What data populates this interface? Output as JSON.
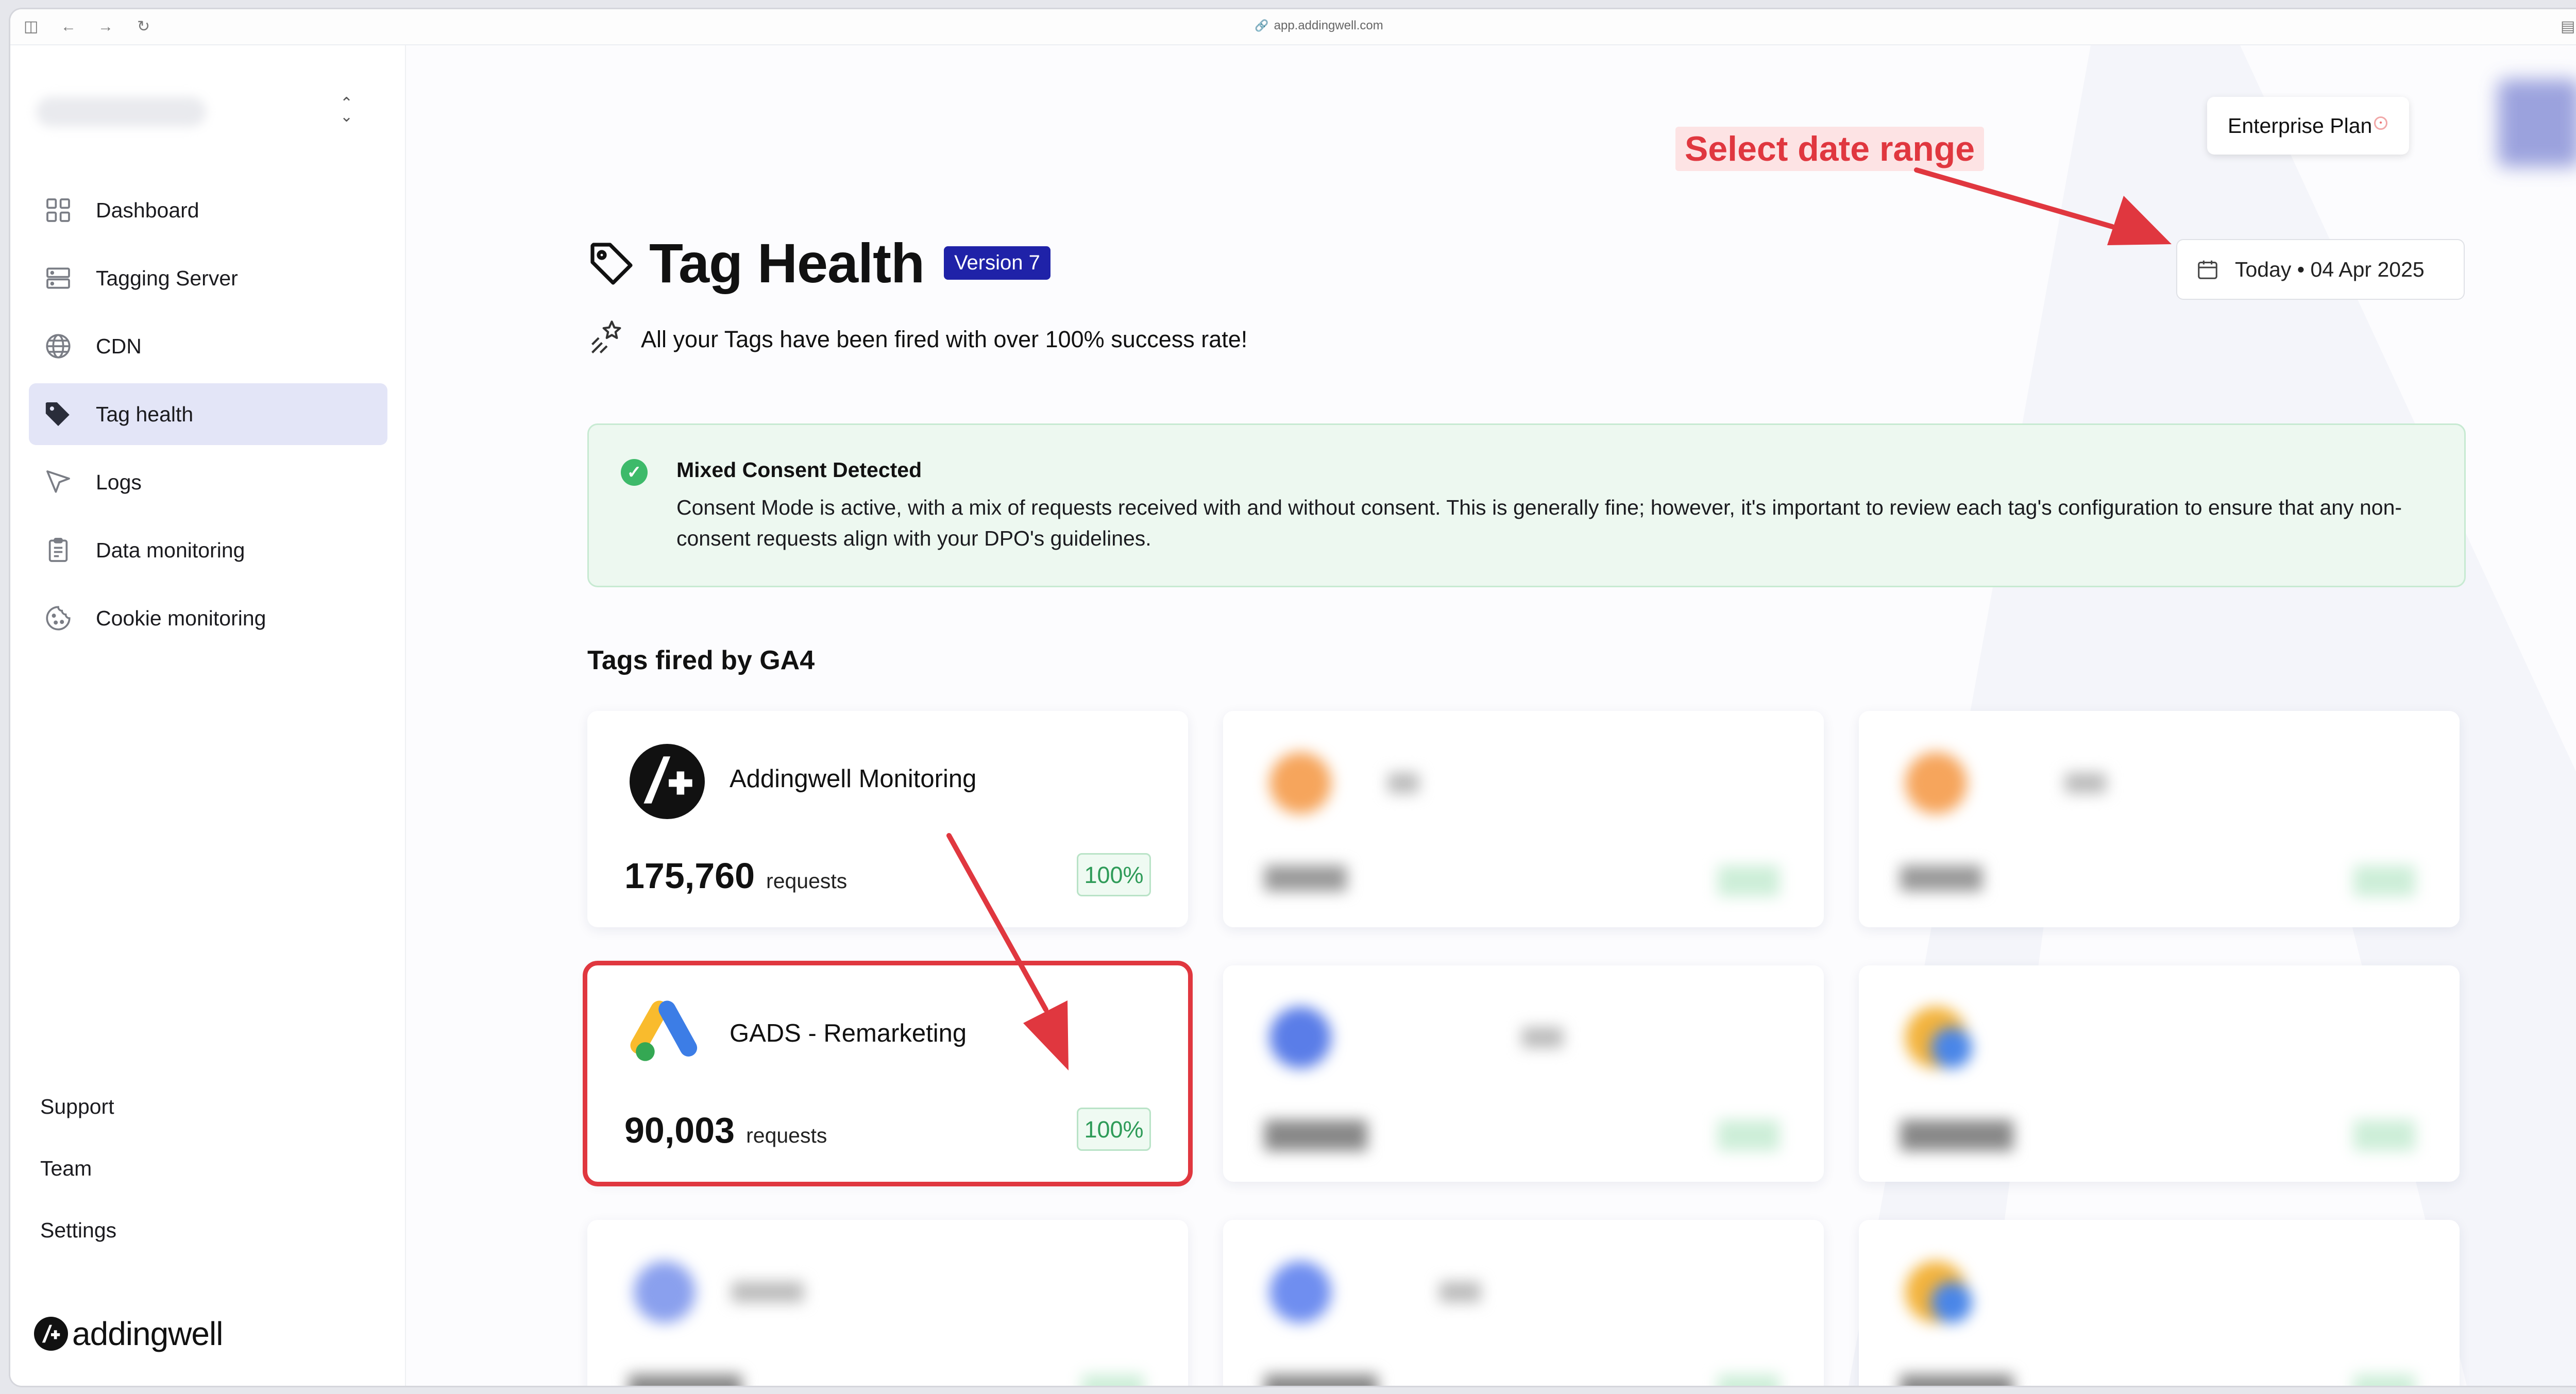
{
  "browser": {
    "url": "app.addingwell.com"
  },
  "sidebar": {
    "items": [
      {
        "label": "Dashboard",
        "icon": "grid-icon"
      },
      {
        "label": "Tagging Server",
        "icon": "server-icon"
      },
      {
        "label": "CDN",
        "icon": "globe-icon"
      },
      {
        "label": "Tag health",
        "icon": "tag-icon",
        "active": true
      },
      {
        "label": "Logs",
        "icon": "cursor-icon"
      },
      {
        "label": "Data monitoring",
        "icon": "clipboard-icon"
      },
      {
        "label": "Cookie monitoring",
        "icon": "cookie-icon"
      }
    ],
    "bottom": {
      "support": "Support",
      "team": "Team",
      "settings": "Settings"
    },
    "logo": "addingwell"
  },
  "header": {
    "plan_label": "Enterprise Plan",
    "date_range": "Today • 04 Apr 2025",
    "annotation": "Select date range"
  },
  "page": {
    "title": "Tag Health",
    "version": "Version 7",
    "subtitle": "All your Tags have been fired with over 100% success rate!"
  },
  "alert": {
    "title": "Mixed Consent Detected",
    "body": "Consent Mode is active, with a mix of requests received with and without consent. This is generally fine; however, it's important to review each tag's configuration to ensure that any non-consent requests align with your DPO's guidelines."
  },
  "section_title": "Tags fired by GA4",
  "tags": [
    {
      "name": "Addingwell Monitoring",
      "count": "175,760",
      "unit": "requests",
      "rate": "100%",
      "icon": "addingwell-logo-icon"
    },
    {
      "name": "GADS - Remarketing",
      "count": "90,003",
      "unit": "requests",
      "rate": "100%",
      "icon": "google-ads-icon",
      "highlighted": true
    }
  ],
  "colors": {
    "accent": "#1f22a8",
    "annotation": "#e0373f",
    "success": "#3dba6a",
    "active_nav": "#e3e5f7"
  }
}
